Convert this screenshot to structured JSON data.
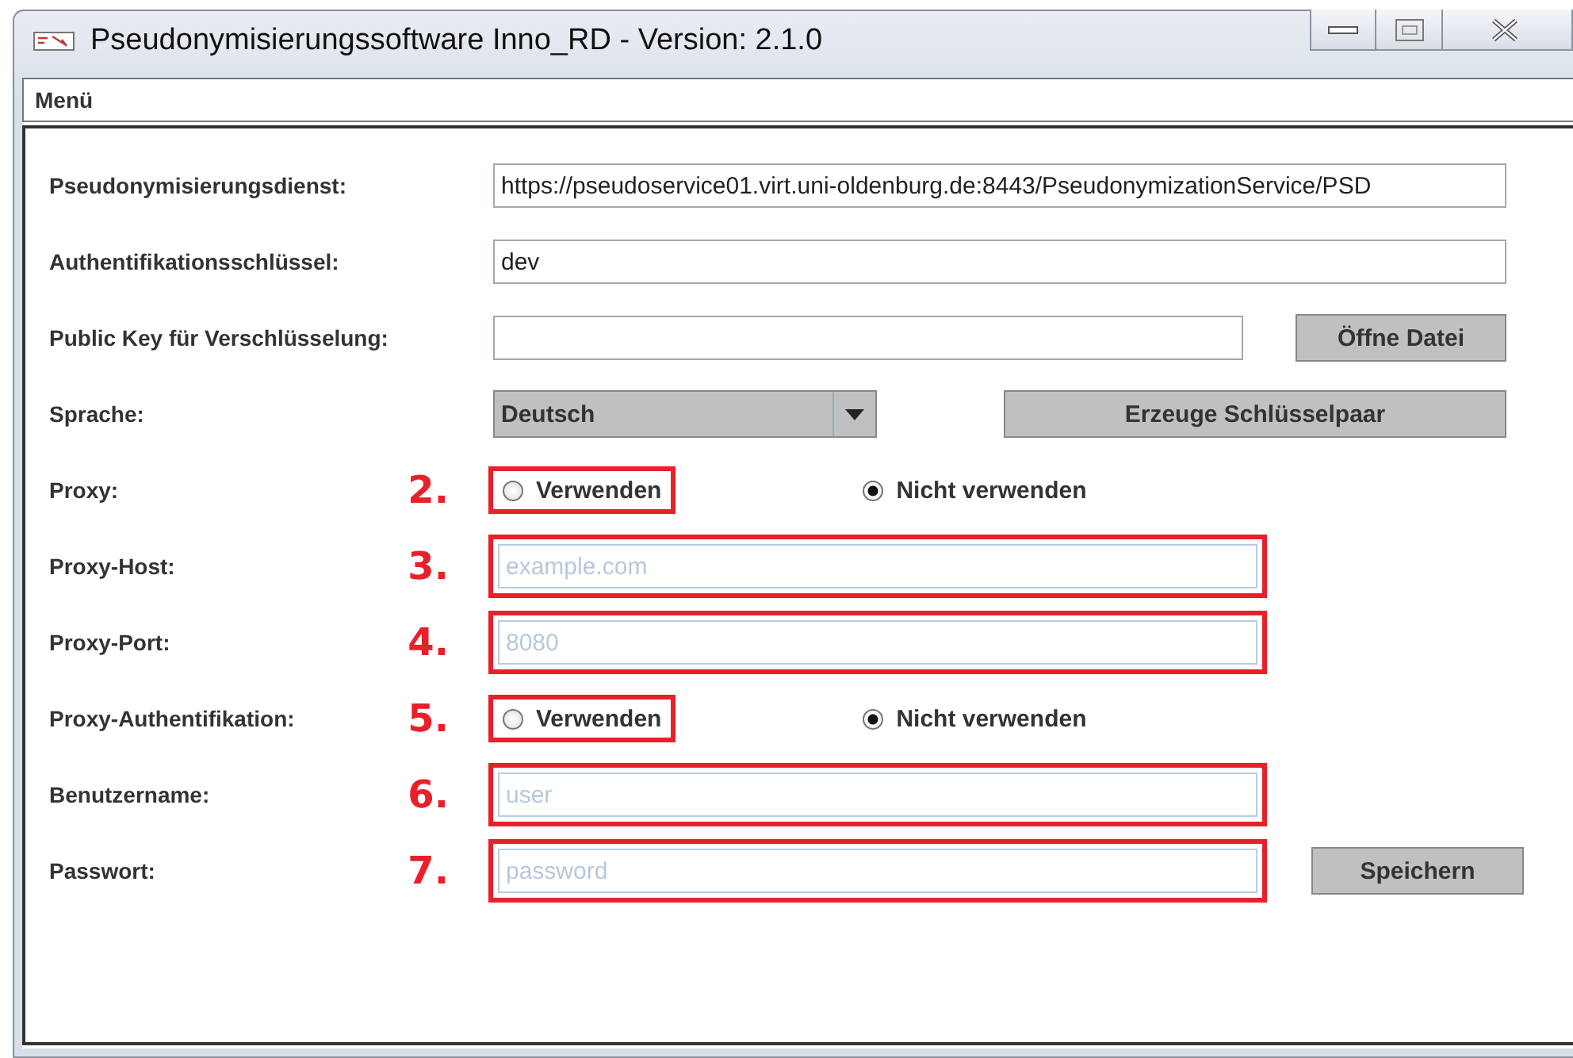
{
  "window": {
    "title": "Pseudonymisierungssoftware Inno_RD - Version: 2.1.0"
  },
  "menu": [
    {
      "label": "Menü"
    }
  ],
  "rows": [
    {
      "kind": "text",
      "label": "Pseudonymisierungsdienst:",
      "value": "https://pseudoservice01.virt.uni-oldenburg.de:8443/PseudonymizationService/PSD"
    },
    {
      "kind": "text",
      "label": "Authentifikationsschlüssel:",
      "value": "dev"
    },
    {
      "kind": "file",
      "label": "Public Key für Verschlüsselung:",
      "button": "Öffne Datei"
    },
    {
      "kind": "combo",
      "label": "Sprache:",
      "value": "Deutsch",
      "button": "Erzeuge Schlüsselpaar"
    },
    {
      "kind": "radio",
      "label": "Proxy:",
      "annotation": "2.",
      "options": [
        {
          "label": "Verwenden",
          "selected": false
        },
        {
          "label": "Nicht verwenden",
          "selected": true
        }
      ]
    },
    {
      "kind": "input",
      "label": "Proxy-Host:",
      "annotation": "3.",
      "placeholder": "example.com"
    },
    {
      "kind": "input",
      "label": "Proxy-Port:",
      "annotation": "4.",
      "placeholder": "8080"
    },
    {
      "kind": "radio",
      "label": "Proxy-Authentifikation:",
      "annotation": "5.",
      "options": [
        {
          "label": "Verwenden",
          "selected": false
        },
        {
          "label": "Nicht verwenden",
          "selected": true
        }
      ]
    },
    {
      "kind": "input",
      "label": "Benutzername:",
      "annotation": "6.",
      "placeholder": "user"
    },
    {
      "kind": "input",
      "label": "Passwort:",
      "annotation": "7.",
      "placeholder": "password",
      "button": "Speichern"
    }
  ]
}
